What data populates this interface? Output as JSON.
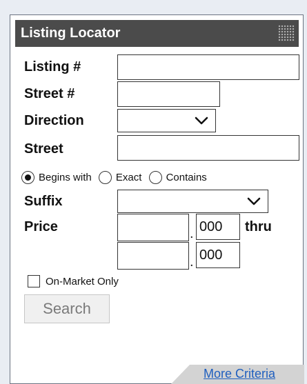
{
  "widget": {
    "title": "Listing Locator",
    "labels": {
      "listing_number": "Listing #",
      "street_number": "Street #",
      "direction": "Direction",
      "street": "Street",
      "suffix": "Suffix",
      "price": "Price",
      "thru": "thru"
    },
    "inputs": {
      "listing_number": "",
      "street_number": "",
      "direction": "",
      "street": "",
      "suffix": "",
      "price_min": "",
      "price_max": ""
    },
    "price_decimal": {
      "dot": ".",
      "suffix_min": "000",
      "suffix_max": "000"
    },
    "match_options": [
      {
        "label": "Begins with",
        "checked": true
      },
      {
        "label": "Exact",
        "checked": false
      },
      {
        "label": "Contains",
        "checked": false
      }
    ],
    "on_market_only": {
      "label": "On-Market Only",
      "checked": false
    },
    "search_button": "Search",
    "more_criteria_link": "More Criteria"
  },
  "colors": {
    "title_bar": "#4b4b4b",
    "link": "#1f5fbf",
    "page_bg": "#e9edf3"
  },
  "icons": {
    "grip": "grip-dots-icon",
    "dropdown": "chevron-down-icon"
  }
}
